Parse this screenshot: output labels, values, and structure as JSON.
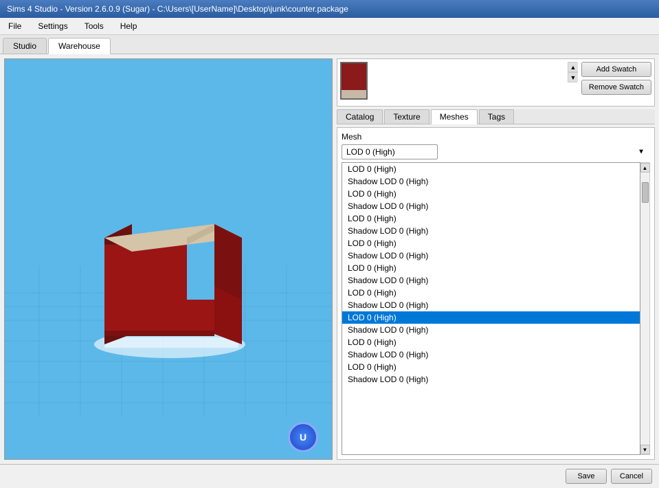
{
  "window": {
    "title": "Sims 4 Studio - Version 2.6.0.9  (Sugar)   - C:\\Users\\[UserName]\\Desktop\\junk\\counter.package"
  },
  "menu": {
    "items": [
      "File",
      "Settings",
      "Tools",
      "Help"
    ]
  },
  "tabs": [
    {
      "label": "Studio",
      "active": false
    },
    {
      "label": "Warehouse",
      "active": true
    }
  ],
  "swatch": {
    "add_button": "Add Swatch",
    "remove_button": "Remove Swatch"
  },
  "sub_tabs": [
    {
      "label": "Catalog",
      "active": false
    },
    {
      "label": "Texture",
      "active": false
    },
    {
      "label": "Meshes",
      "active": true
    },
    {
      "label": "Tags",
      "active": false
    }
  ],
  "mesh": {
    "label": "Mesh",
    "dropdown_value": "LOD 0 (High)",
    "dropdown_arrow": "▼",
    "list_items": [
      {
        "label": "LOD 0 (High)",
        "selected": false
      },
      {
        "label": "Shadow LOD 0 (High)",
        "selected": false
      },
      {
        "label": "LOD 0 (High)",
        "selected": false
      },
      {
        "label": "Shadow LOD 0 (High)",
        "selected": false
      },
      {
        "label": "LOD 0 (High)",
        "selected": false
      },
      {
        "label": "Shadow LOD 0 (High)",
        "selected": false
      },
      {
        "label": "LOD 0 (High)",
        "selected": false
      },
      {
        "label": "Shadow LOD 0 (High)",
        "selected": false
      },
      {
        "label": "LOD 0 (High)",
        "selected": false
      },
      {
        "label": "Shadow LOD 0 (High)",
        "selected": false
      },
      {
        "label": "LOD 0 (High)",
        "selected": false
      },
      {
        "label": "Shadow LOD 0 (High)",
        "selected": false
      },
      {
        "label": "LOD 0 (High)",
        "selected": true
      },
      {
        "label": "Shadow LOD 0 (High)",
        "selected": false
      },
      {
        "label": "LOD 0 (High)",
        "selected": false
      },
      {
        "label": "Shadow LOD 0 (High)",
        "selected": false
      },
      {
        "label": "LOD 0 (High)",
        "selected": false
      },
      {
        "label": "Shadow LOD 0 (High)",
        "selected": false
      }
    ]
  },
  "bottom": {
    "save_label": "Save",
    "cancel_label": "Cancel"
  },
  "viewport": {
    "logo": "U"
  }
}
